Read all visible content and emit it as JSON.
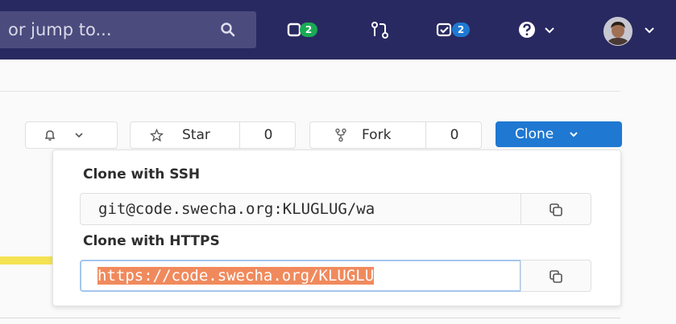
{
  "search": {
    "placeholder": "or jump to..."
  },
  "nav": {
    "issues_badge": "2",
    "todos_badge": "2"
  },
  "project_actions": {
    "star_label": "Star",
    "star_count": "0",
    "fork_label": "Fork",
    "fork_count": "0",
    "clone_label": "Clone"
  },
  "clone_dropdown": {
    "ssh_heading": "Clone with SSH",
    "ssh_url": "git@code.swecha.org:KLUGLUG/wa",
    "https_heading": "Clone with HTTPS",
    "https_url": "https://code.swecha.org/KLUGLU"
  },
  "colors": {
    "topbar": "#292961",
    "badge_green": "#1aaa55",
    "badge_blue": "#1f78d1",
    "clone_button": "#1f78d1",
    "selection": "#f08a5d"
  }
}
